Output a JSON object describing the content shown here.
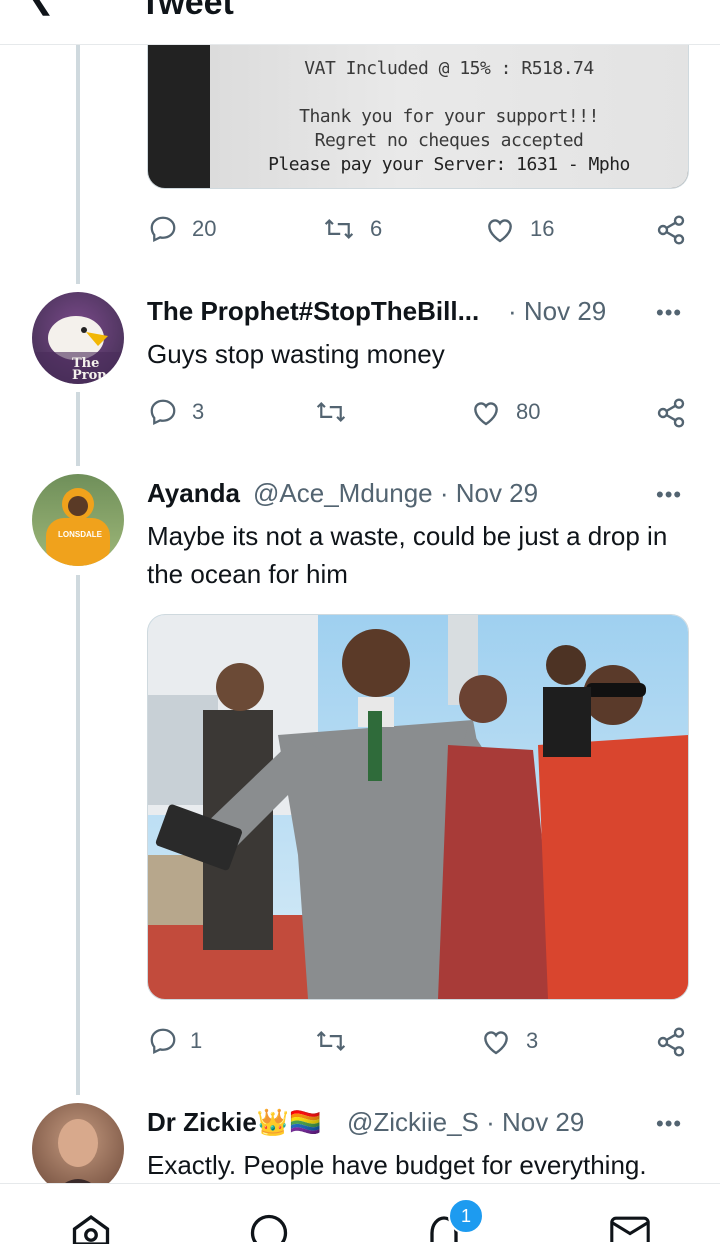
{
  "header": {
    "title": "Tweet",
    "back_icon": "arrow-left-icon"
  },
  "receipt_tweet": {
    "receipt_lines": [
      "VAT Included @ 15%   :     R518.74",
      "Thank you for your support!!!",
      "Regret no cheques accepted",
      "Please pay your Server: 1631 - Mpho"
    ],
    "replies": "20",
    "retweets": "6",
    "likes": "16"
  },
  "tweets": [
    {
      "name": "The Prophet#StopTheBill...",
      "meta": "· Nov 29",
      "text": "Guys stop wasting money",
      "avatar_text": "The Prop",
      "replies": "3",
      "retweets": "",
      "likes": "80"
    },
    {
      "name": "Ayanda",
      "meta": "@Ace_Mdunge · Nov 29",
      "text": "Maybe its not a waste, could be just a drop in the ocean for him",
      "avatar_text": "LONSDALE",
      "replies": "1",
      "retweets": "",
      "likes": "3"
    },
    {
      "name": "Dr Zickie👑🏳️‍🌈",
      "meta": "@Zickiie_S · Nov 29",
      "text": "Exactly. People have budget for everything."
    }
  ],
  "more_label": "•••",
  "nav": {
    "badge": "1",
    "items": [
      "home-icon",
      "search-icon",
      "notifications-icon",
      "messages-icon"
    ]
  },
  "colors": {
    "accent": "#1d9bf0",
    "muted": "#536471",
    "line": "#cfd9de"
  }
}
